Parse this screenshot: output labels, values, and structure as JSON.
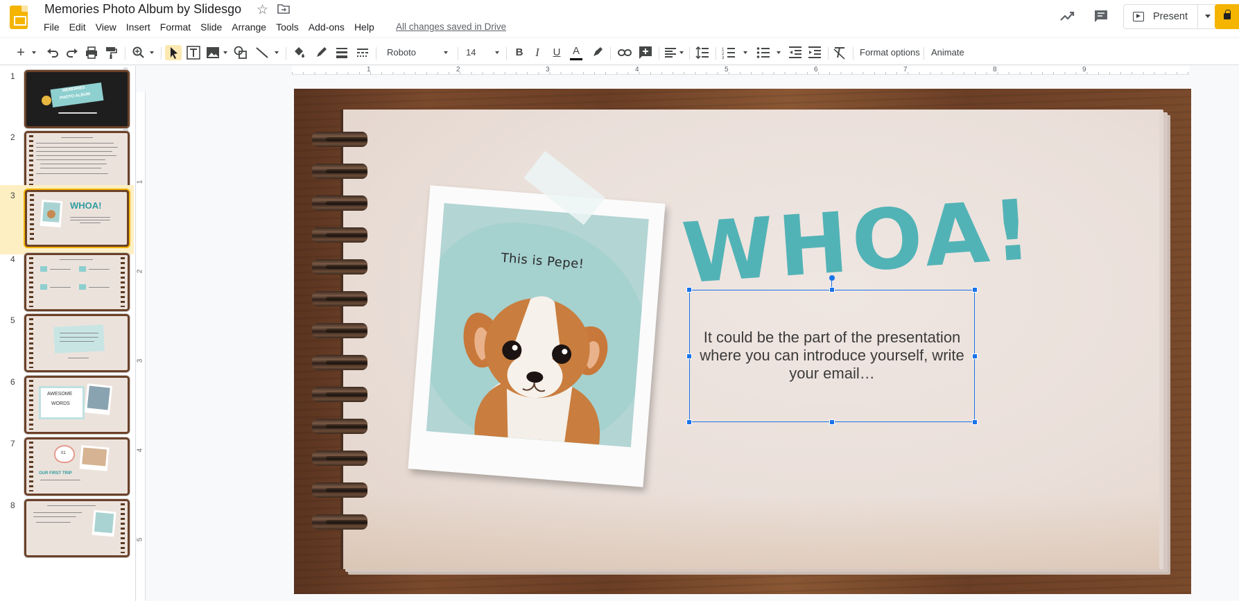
{
  "app": {
    "title": "Memories Photo Album by Slidesgo",
    "save_status": "All changes saved in Drive",
    "present_label": "Present"
  },
  "menu": [
    "File",
    "Edit",
    "View",
    "Insert",
    "Format",
    "Slide",
    "Arrange",
    "Tools",
    "Add-ons",
    "Help"
  ],
  "toolbar": {
    "font": "Roboto",
    "font_size": "14",
    "format_options": "Format options",
    "animate": "Animate"
  },
  "ruler": {
    "h_numbers": [
      "1",
      "2",
      "3",
      "4",
      "5",
      "6",
      "7",
      "8",
      "9"
    ],
    "v_numbers": [
      "1",
      "2",
      "3",
      "4",
      "5"
    ]
  },
  "filmstrip": {
    "active_index": 3,
    "slides": [
      {
        "num": "1"
      },
      {
        "num": "2"
      },
      {
        "num": "3"
      },
      {
        "num": "4"
      },
      {
        "num": "5"
      },
      {
        "num": "6"
      },
      {
        "num": "7"
      },
      {
        "num": "8"
      }
    ],
    "thumb_texts": {
      "s1_title_a": "MEMORIES",
      "s1_title_b": "PHOTO ALBUM",
      "s3_title": "WHOA!",
      "s6_a": "AWESOME",
      "s6_b": "WORDS",
      "s7_num": "01",
      "s7_title": "OUR FIRST TRIP"
    }
  },
  "slide": {
    "heading": "WHOA!",
    "photo_caption": "This is Pepe!",
    "body": "It could be the part of the presentation where you can introduce yourself, write your email…"
  },
  "colors": {
    "accent_yellow": "#f4b400",
    "teal": "#52b3b6",
    "selection_blue": "#1a73e8"
  }
}
